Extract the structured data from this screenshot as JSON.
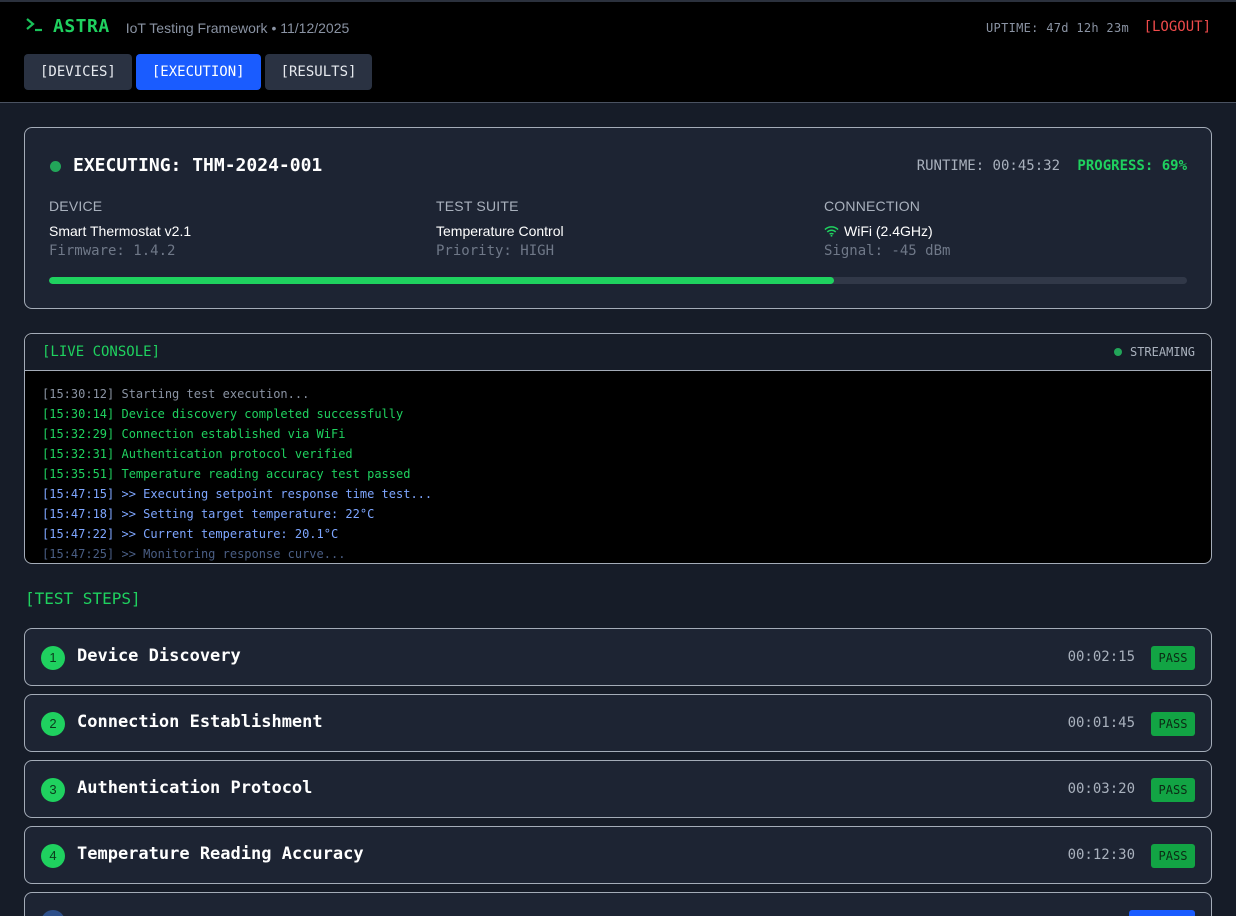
{
  "header": {
    "prompt_icon": "terminal-prompt-icon",
    "brand": "ASTRA",
    "subtitle": "IoT Testing Framework • 11/12/2025",
    "uptime": "UPTIME: 47d 12h 23m",
    "logout": "[LOGOUT]",
    "tabs": [
      {
        "label": "[DEVICES]",
        "active": false
      },
      {
        "label": "[EXECUTION]",
        "active": true
      },
      {
        "label": "[RESULTS]",
        "active": false
      }
    ]
  },
  "execution": {
    "title": "EXECUTING: THM-2024-001",
    "runtime": "RUNTIME: 00:45:32",
    "progress_label": "PROGRESS: 69%",
    "progress": 0.69,
    "device": {
      "label": "DEVICE",
      "value": "Smart Thermostat v2.1",
      "sub": "Firmware: 1.4.2"
    },
    "suite": {
      "label": "TEST SUITE",
      "value": "Temperature Control",
      "sub": "Priority: HIGH"
    },
    "connection": {
      "label": "CONNECTION",
      "value": "WiFi (2.4GHz)",
      "sub": "Signal: -45 dBm",
      "icon": "wifi-icon"
    }
  },
  "console": {
    "title": "[LIVE CONSOLE]",
    "status": "STREAMING",
    "lines": [
      {
        "text": "[15:30:12] Starting test execution...",
        "level": "info"
      },
      {
        "text": "[15:30:14] Device discovery completed successfully",
        "level": "ok"
      },
      {
        "text": "[15:32:29] Connection established via WiFi",
        "level": "ok"
      },
      {
        "text": "[15:32:31] Authentication protocol verified",
        "level": "ok"
      },
      {
        "text": "[15:35:51] Temperature reading accuracy test passed",
        "level": "ok"
      },
      {
        "text": "[15:47:15] >> Executing setpoint response time test...",
        "level": "run"
      },
      {
        "text": "[15:47:18] >> Setting target temperature: 22°C",
        "level": "run"
      },
      {
        "text": "[15:47:22] >> Current temperature: 20.1°C",
        "level": "run"
      },
      {
        "text": "[15:47:25] >> Monitoring response curve...",
        "level": "dim"
      }
    ]
  },
  "steps": {
    "title": "[TEST STEPS]",
    "items": [
      {
        "num": "1",
        "name": "Device Discovery",
        "time": "00:02:15",
        "status": "PASS"
      },
      {
        "num": "2",
        "name": "Connection Establishment",
        "time": "00:01:45",
        "status": "PASS"
      },
      {
        "num": "3",
        "name": "Authentication Protocol",
        "time": "00:03:20",
        "status": "PASS"
      },
      {
        "num": "4",
        "name": "Temperature Reading Accuracy",
        "time": "00:12:30",
        "status": "PASS"
      }
    ]
  },
  "colors": {
    "accent_green": "#1fd15f",
    "accent_blue": "#1a5cff",
    "danger": "#f04b4b",
    "background": "#161c28"
  }
}
